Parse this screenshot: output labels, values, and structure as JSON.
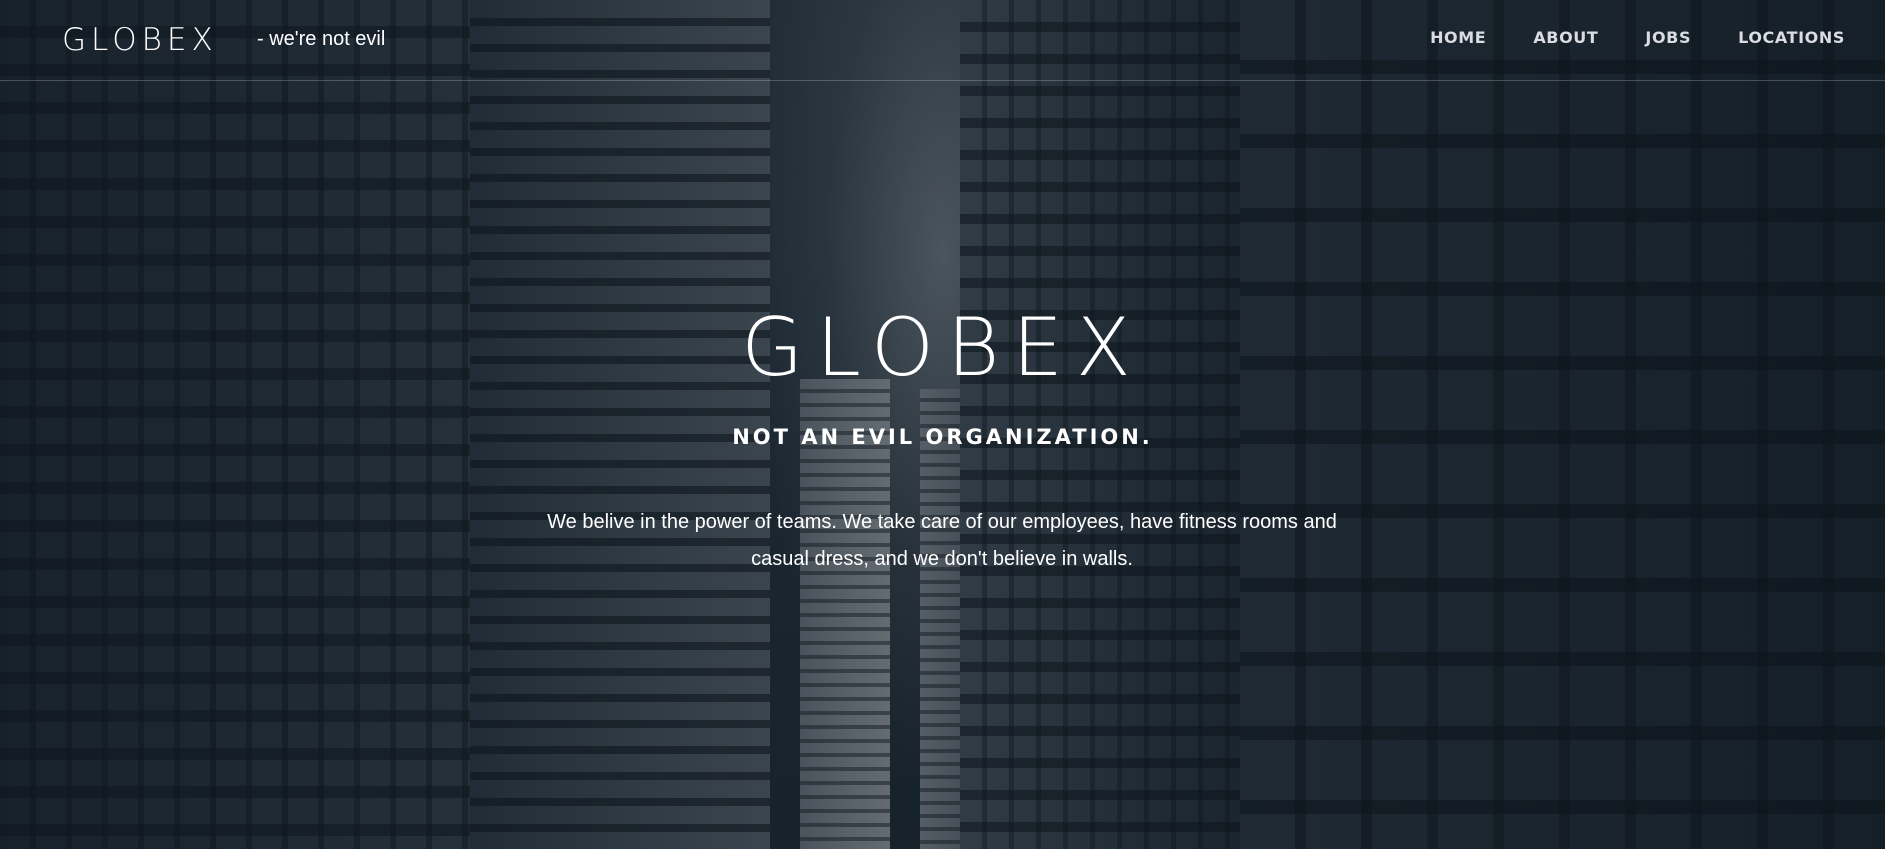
{
  "header": {
    "brand": "GLOBEX",
    "tagline": "- we're not evil",
    "nav": [
      {
        "label": "HOME"
      },
      {
        "label": "ABOUT"
      },
      {
        "label": "JOBS"
      },
      {
        "label": "LOCATIONS"
      }
    ]
  },
  "hero": {
    "title": "GLOBEX",
    "subtitle": "NOT AN EVIL ORGANIZATION.",
    "description": "We belive in the power of teams. We take care of our employees, have fitness rooms and casual dress, and we don't believe in walls."
  },
  "colors": {
    "text": "#ffffff",
    "nav_text": "#d9dde1",
    "overlay": "#121c26"
  }
}
